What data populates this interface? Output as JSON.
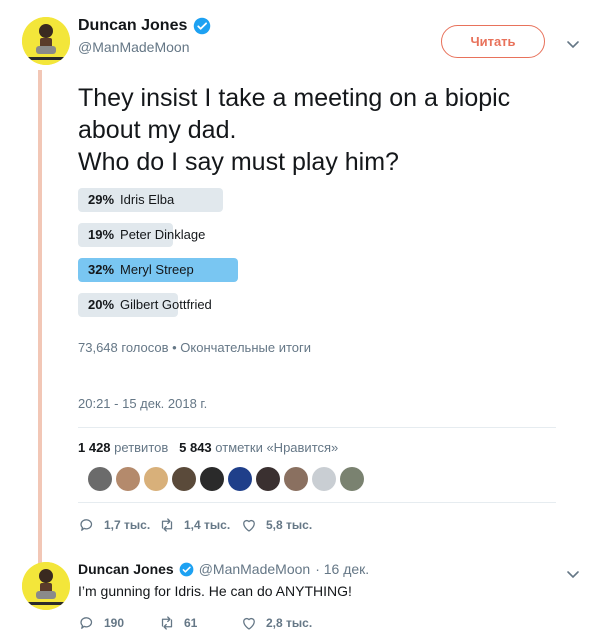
{
  "tweet": {
    "author_name": "Duncan Jones",
    "author_handle": "@ManMadeMoon",
    "follow_label": "Читать",
    "text_lines": [
      "They insist I take a meeting on a biopic",
      "about my dad.",
      "Who do I say must play him?"
    ],
    "poll": {
      "options": [
        {
          "percent": 29,
          "percent_label": "29%",
          "label": "Idris Elba",
          "winner": false
        },
        {
          "percent": 19,
          "percent_label": "19%",
          "label": "Peter Dinklage",
          "winner": false
        },
        {
          "percent": 32,
          "percent_label": "32%",
          "label": "Meryl Streep",
          "winner": true
        },
        {
          "percent": 20,
          "percent_label": "20%",
          "label": "Gilbert Gottfried",
          "winner": false
        }
      ],
      "meta": "73,648 голосов • Окончательные итоги"
    },
    "timestamp": "20:21 - 15 дек. 2018 г.",
    "stats": {
      "retweets_count": "1 428",
      "retweets_label": "ретвитов",
      "likes_count": "5 843",
      "likes_label": "отметки «Нравится»"
    },
    "liker_colors": [
      "#6b6b6b",
      "#b48a6c",
      "#d8b07a",
      "#5a4a3a",
      "#2a2a2a",
      "#1f3f8a",
      "#3a3030",
      "#8a7060",
      "#c9ced3",
      "#7a8270"
    ],
    "actions": {
      "replies": "1,7 тыс.",
      "retweets": "1,4 тыс.",
      "likes": "5,8 тыс."
    }
  },
  "reply": {
    "author_name": "Duncan Jones",
    "author_handle": "@ManMadeMoon",
    "date": "· 16 дек.",
    "text": "I’m gunning for Idris.  He can do ANYTHING!",
    "actions": {
      "replies": "190",
      "retweets": "61",
      "likes": "2,8 тыс."
    }
  },
  "colors": {
    "accent": "#e8725b",
    "verified": "#1da1f2",
    "poll_winner": "#79c6f2",
    "poll_bar": "#e1e8ed",
    "thread_line": "#f2c7b6"
  }
}
